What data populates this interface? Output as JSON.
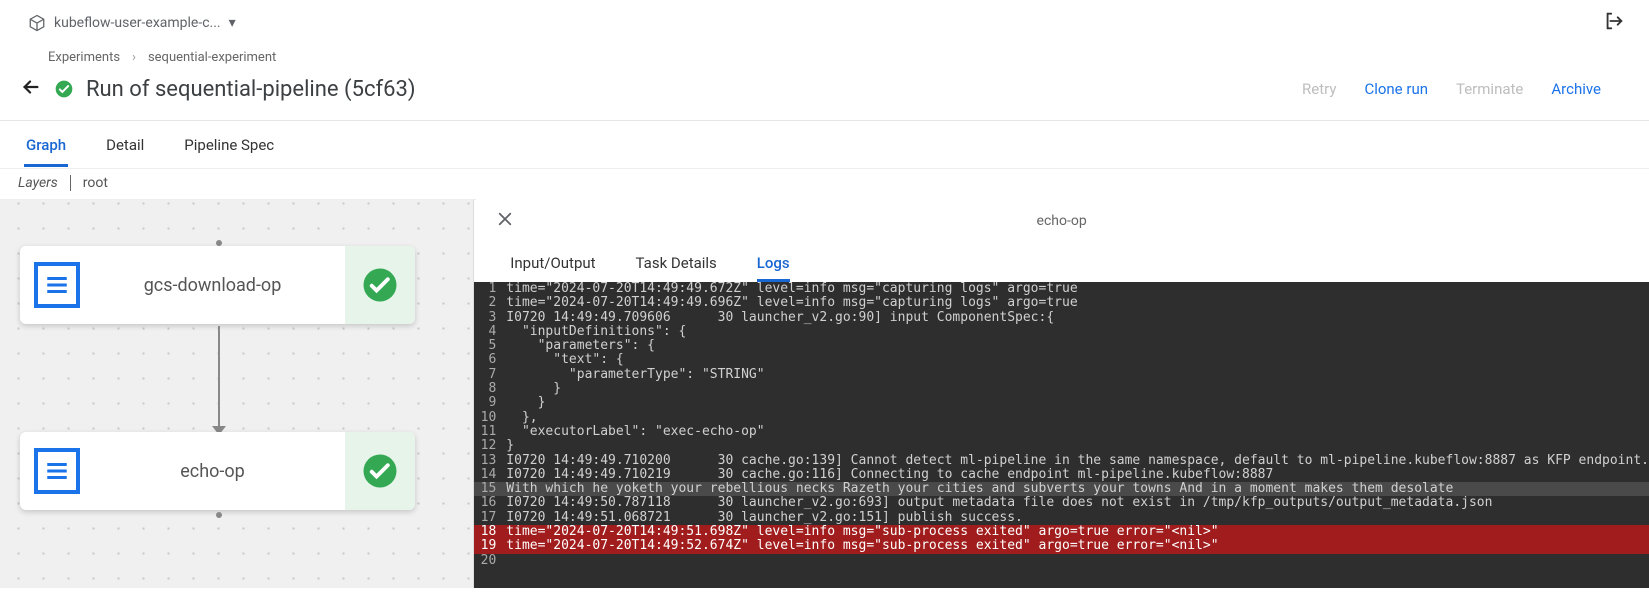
{
  "header": {
    "namespace": "kubeflow-user-example-c..."
  },
  "breadcrumb": {
    "root": "Experiments",
    "leaf": "sequential-experiment"
  },
  "title": "Run of sequential-pipeline (5cf63)",
  "actions": {
    "retry": "Retry",
    "clone": "Clone run",
    "terminate": "Terminate",
    "archive": "Archive"
  },
  "main_tabs": {
    "graph": "Graph",
    "detail": "Detail",
    "spec": "Pipeline Spec"
  },
  "layers": {
    "label": "Layers",
    "root": "root"
  },
  "nodes": {
    "n1": "gcs-download-op",
    "n2": "echo-op"
  },
  "panel": {
    "title": "echo-op",
    "tabs": {
      "io": "Input/Output",
      "task": "Task Details",
      "logs": "Logs"
    }
  },
  "log_lines": [
    {
      "n": 1,
      "t": "time=\"2024-07-20T14:49:49.672Z\" level=info msg=\"capturing logs\" argo=true"
    },
    {
      "n": 2,
      "t": "time=\"2024-07-20T14:49:49.696Z\" level=info msg=\"capturing logs\" argo=true"
    },
    {
      "n": 3,
      "t": "I0720 14:49:49.709606      30 launcher_v2.go:90] input ComponentSpec:{"
    },
    {
      "n": 4,
      "t": "  \"inputDefinitions\": {"
    },
    {
      "n": 5,
      "t": "    \"parameters\": {"
    },
    {
      "n": 6,
      "t": "      \"text\": {"
    },
    {
      "n": 7,
      "t": "        \"parameterType\": \"STRING\""
    },
    {
      "n": 8,
      "t": "      }"
    },
    {
      "n": 9,
      "t": "    }"
    },
    {
      "n": 10,
      "t": "  },"
    },
    {
      "n": 11,
      "t": "  \"executorLabel\": \"exec-echo-op\""
    },
    {
      "n": 12,
      "t": "}"
    },
    {
      "n": 13,
      "t": "I0720 14:49:49.710200      30 cache.go:139] Cannot detect ml-pipeline in the same namespace, default to ml-pipeline.kubeflow:8887 as KFP endpoint."
    },
    {
      "n": 14,
      "t": "I0720 14:49:49.710219      30 cache.go:116] Connecting to cache endpoint ml-pipeline.kubeflow:8887"
    },
    {
      "n": 15,
      "t": "With which he yoketh your rebellious necks Razeth your cities and subverts your towns And in a moment makes them desolate",
      "sel": true
    },
    {
      "n": 16,
      "t": "I0720 14:49:50.787118      30 launcher_v2.go:693] output metadata file does not exist in /tmp/kfp_outputs/output_metadata.json"
    },
    {
      "n": 17,
      "t": "I0720 14:49:51.068721      30 launcher_v2.go:151] publish success."
    },
    {
      "n": 18,
      "t": "time=\"2024-07-20T14:49:51.698Z\" level=info msg=\"sub-process exited\" argo=true error=\"<nil>\"",
      "err": true
    },
    {
      "n": 19,
      "t": "time=\"2024-07-20T14:49:52.674Z\" level=info msg=\"sub-process exited\" argo=true error=\"<nil>\"",
      "err": true
    },
    {
      "n": 20,
      "t": ""
    }
  ]
}
